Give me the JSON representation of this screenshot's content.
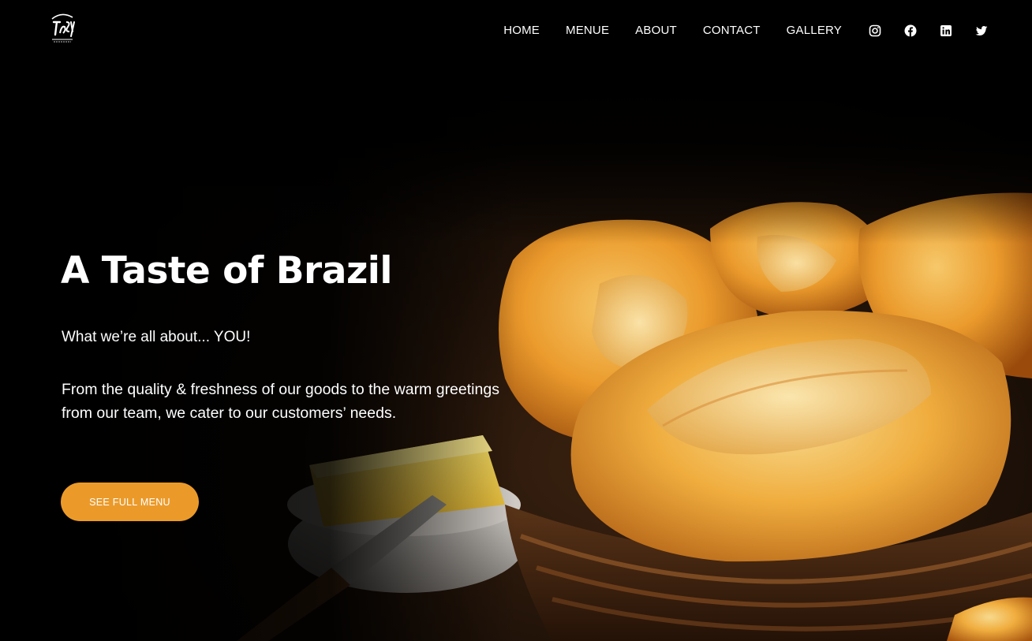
{
  "header": {
    "logo_icon": "tasty-bakery-logo",
    "nav": [
      {
        "label": "HOME"
      },
      {
        "label": "MENUE"
      },
      {
        "label": "ABOUT"
      },
      {
        "label": "CONTACT"
      },
      {
        "label": "GALLERY"
      }
    ],
    "social": [
      {
        "icon": "instagram-icon"
      },
      {
        "icon": "facebook-icon"
      },
      {
        "icon": "linkedin-icon"
      },
      {
        "icon": "twitter-icon"
      }
    ]
  },
  "hero": {
    "title": "A Taste of Brazil",
    "tagline": "What we’re all about... YOU!",
    "body": "From the quality & freshness of our goods to the warm greetings from our team, we cater to our customers’ needs.",
    "cta_label": "SEE FULL MENU",
    "image_subject": "basket of Brazilian bread rolls with butter dish and knife"
  },
  "colors": {
    "background": "#000000",
    "accent": "#eb9a2a",
    "text": "#ffffff"
  }
}
